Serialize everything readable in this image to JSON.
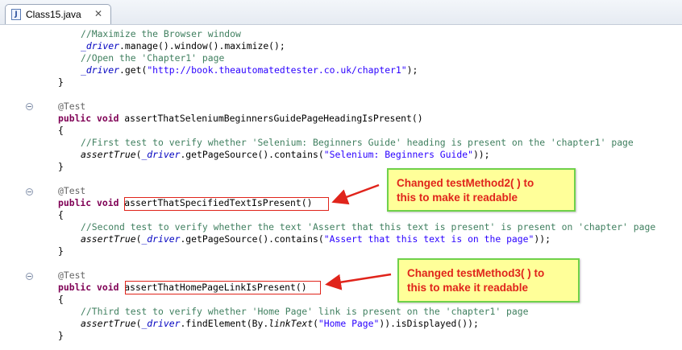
{
  "tab": {
    "label": "Class15.java",
    "icon": "java-file-icon",
    "close": "✕"
  },
  "code": {
    "l1": "//Maximize the Browser window",
    "l2a": "_driver",
    "l2b": ".manage().window().maximize();",
    "l3": "//Open the 'Chapter1' page",
    "l4a": "_driver",
    "l4b": ".get(",
    "l4c": "\"http://book.theautomatedtester.co.uk/chapter1\"",
    "l4d": ");",
    "brace_close": "}",
    "brace_open": "{",
    "annotation": "@Test",
    "public_void": "public void",
    "m1": "assertThatSeleniumBeginnersGuidePageHeadingIsPresent()",
    "m1_comment": "//First test to verify whether 'Selenium: Beginners Guide' heading is present on the 'chapter1' page",
    "m1_assert": "assertTrue",
    "m1_drv": "_driver",
    "m1_mid": ".getPageSource().contains(",
    "m1_str": "\"Selenium: Beginners Guide\"",
    "m1_end": "));",
    "m2": "assertThatSpecifiedTextIsPresent()",
    "m2_comment": "//Second test to verify whether the text 'Assert that this text is present' is present on 'chapter' page",
    "m2_str": "\"Assert that this text is on the page\"",
    "m3": "assertThatHomePageLinkIsPresent()",
    "m3_comment": "//Third test to verify whether 'Home Page' link is present on the 'chapter1' page",
    "m3_mid1": ".findElement(By.",
    "m3_link": "linkText",
    "m3_mid2": "(",
    "m3_str": "\"Home Page\"",
    "m3_end": ")).isDisplayed());"
  },
  "notes": {
    "n1_line1": "Changed testMethod2( ) to",
    "n1_line2": "this to make it readable",
    "n2_line1": "Changed testMethod3( ) to",
    "n2_line2": "this to make it readable"
  },
  "colors": {
    "note_text": "#e0241b",
    "note_bg": "#ffff99",
    "note_border": "#6fd14a",
    "arrow": "#e0241b"
  }
}
